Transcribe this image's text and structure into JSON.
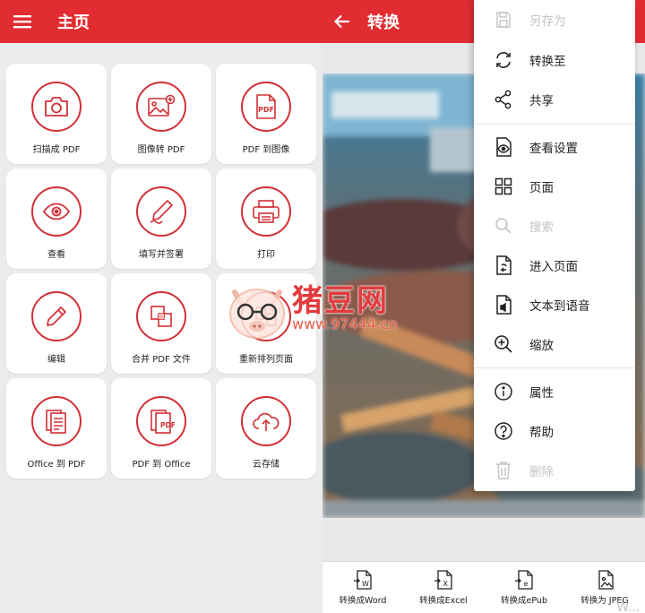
{
  "left_screen": {
    "title": "主页",
    "tiles": [
      {
        "label": "扫描成 PDF",
        "icon": "camera-icon"
      },
      {
        "label": "图像转 PDF",
        "icon": "image-add-icon"
      },
      {
        "label": "PDF 到图像",
        "icon": "pdf-file-icon",
        "icon_text": "PDF"
      },
      {
        "label": "查看",
        "icon": "eye-icon"
      },
      {
        "label": "填写并签署",
        "icon": "signature-pen-icon"
      },
      {
        "label": "打印",
        "icon": "printer-icon"
      },
      {
        "label": "编辑",
        "icon": "pencil-icon"
      },
      {
        "label": "合并 PDF 文件",
        "icon": "merge-icon"
      },
      {
        "label": "重新排列页面",
        "icon": "reorder-pages-icon"
      },
      {
        "label": "Office 到 PDF",
        "icon": "office-doc-icon"
      },
      {
        "label": "PDF 到 Office",
        "icon": "pdf-to-office-icon",
        "icon_text": "PDF"
      },
      {
        "label": "云存储",
        "icon": "cloud-upload-icon"
      }
    ]
  },
  "right_screen": {
    "title": "转换",
    "menu": [
      {
        "label": "另存为",
        "icon": "save-as-icon",
        "disabled": true
      },
      {
        "label": "转换至",
        "icon": "convert-icon",
        "disabled": false
      },
      {
        "label": "共享",
        "icon": "share-icon",
        "disabled": false
      },
      {
        "label": "查看设置",
        "icon": "view-settings-icon",
        "disabled": false
      },
      {
        "label": "页面",
        "icon": "grid-pages-icon",
        "disabled": false
      },
      {
        "label": "搜索",
        "icon": "search-icon",
        "disabled": true
      },
      {
        "label": "进入页面",
        "icon": "goto-page-icon",
        "disabled": false
      },
      {
        "label": "文本到语音",
        "icon": "text-to-speech-icon",
        "disabled": false
      },
      {
        "label": "缩放",
        "icon": "zoom-icon",
        "disabled": false
      },
      {
        "label": "属性",
        "icon": "info-icon",
        "disabled": false
      },
      {
        "label": "帮助",
        "icon": "help-icon",
        "disabled": false
      },
      {
        "label": "删除",
        "icon": "trash-icon",
        "disabled": true
      }
    ],
    "bottom_actions": [
      {
        "label": "转换成Word",
        "icon": "word-convert-icon",
        "icon_text": "W"
      },
      {
        "label": "转换成Excel",
        "icon": "excel-convert-icon",
        "icon_text": "X"
      },
      {
        "label": "转换成ePub",
        "icon": "epub-convert-icon",
        "icon_text": "e"
      },
      {
        "label": "转换为 JPEG",
        "icon": "jpeg-convert-icon",
        "icon_text": ""
      }
    ]
  },
  "watermark": {
    "brand": "猪豆网",
    "url": "www.97444.cn",
    "corner": "W..."
  },
  "colors": {
    "accent": "#e12c32",
    "icon_red": "#d23036",
    "text": "#222222",
    "disabled": "#c3c3c3"
  }
}
